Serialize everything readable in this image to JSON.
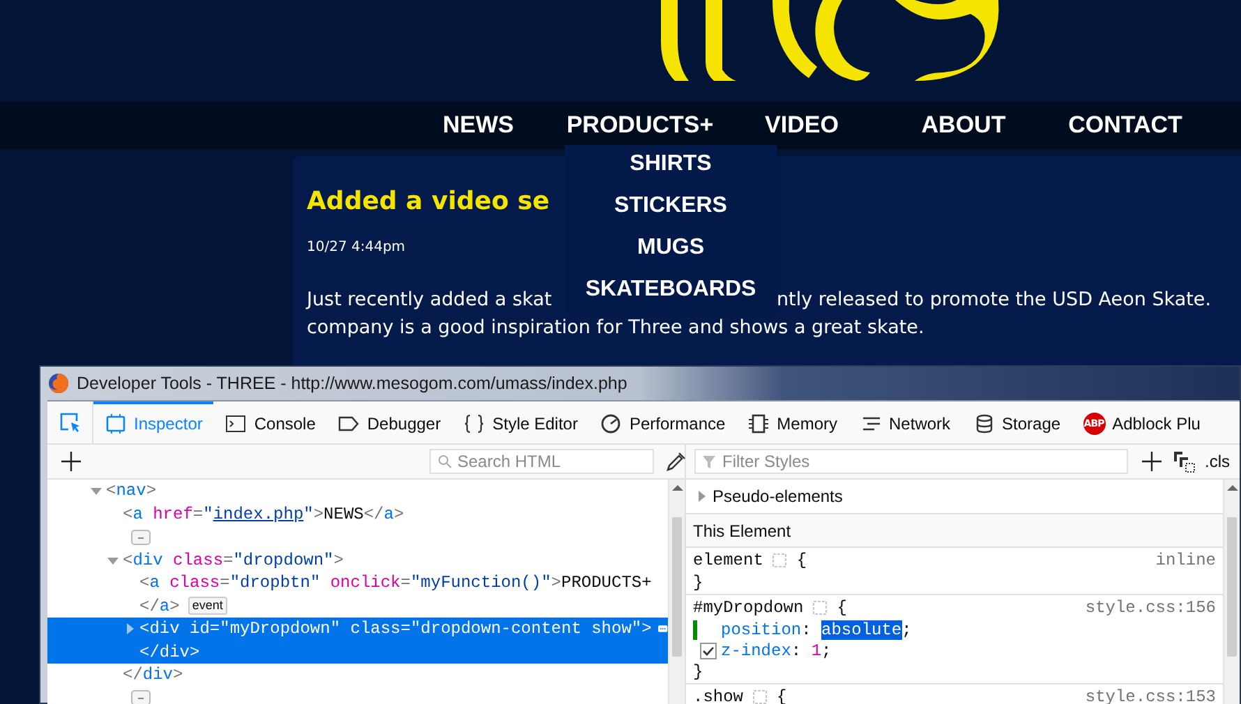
{
  "website": {
    "nav": [
      {
        "label": "NEWS"
      },
      {
        "label": "PRODUCTS+",
        "expanded": true,
        "items": [
          "SHIRTS",
          "STICKERS",
          "MUGS",
          "SKATEBOARDS"
        ]
      },
      {
        "label": "VIDEO"
      },
      {
        "label": "ABOUT"
      },
      {
        "label": "CONTACT"
      }
    ],
    "article": {
      "title": "Added a video se",
      "date": "10/27 4:44pm",
      "line_1_left": "Just recently added a skat",
      "line_1_right": "ntly released to promote the USD Aeon Skate.",
      "line_2": "company is a good inspiration for Three and shows a great skate."
    }
  },
  "devtools": {
    "title": "Developer Tools - THREE - http://www.mesogom.com/umass/index.php",
    "tabs": [
      {
        "kind": "inspector",
        "label": "Inspector",
        "selected": true
      },
      {
        "kind": "console",
        "label": "Console",
        "selected": false
      },
      {
        "kind": "debugger",
        "label": "Debugger",
        "selected": false
      },
      {
        "kind": "style",
        "label": "Style Editor",
        "selected": false
      },
      {
        "kind": "performance",
        "label": "Performance",
        "selected": false
      },
      {
        "kind": "memory",
        "label": "Memory",
        "selected": false
      },
      {
        "kind": "network",
        "label": "Network",
        "selected": false
      },
      {
        "kind": "storage",
        "label": "Storage",
        "selected": false
      },
      {
        "kind": "adblock",
        "label": "Adblock Plu",
        "icon_text": "ABP",
        "selected": false
      }
    ],
    "search_placeholder": "Search HTML",
    "filter_placeholder": "Filter Styles",
    "cls_label": ".cls",
    "markup": [
      {
        "text": "<nav>",
        "expanded": true,
        "selected": false,
        "children": [
          {
            "text": "<a href=\"index.php\">NEWS</a>",
            "link": true,
            "selected": false
          },
          {
            "kind": "whitespace"
          },
          {
            "text": "<div class=\"dropdown\">",
            "expanded": true,
            "selected": false,
            "children": [
              {
                "text": "<a class=\"dropbtn\" onclick=\"myFunction()\">PRODUCTS+",
                "continuation": "</a>",
                "badge": "event",
                "selected": false
              },
              {
                "text": "<div id=\"myDropdown\" class=\"dropdown-content show\">",
                "expanded": false,
                "collapsed_content": true,
                "continuation": "</div>",
                "selected": true
              }
            ],
            "closing": "</div>"
          },
          {
            "kind": "whitespace"
          }
        ]
      }
    ],
    "pseudo": {
      "label": "Pseudo-elements",
      "expanded": false
    },
    "section": "This Element",
    "rules": [
      {
        "selector": "element",
        "open_brace": "{",
        "source": "inline",
        "close_brace": "}"
      },
      {
        "selector": "#myDropdown",
        "open_brace": "{",
        "source": "style.css:156",
        "close_brace": "}",
        "declarations": [
          {
            "property": "position",
            "colon": ":",
            "value": "absolute",
            "semicolon": ";",
            "modified": true,
            "value_selected": true
          },
          {
            "property": "z-index",
            "colon": ":",
            "value": "1",
            "semicolon": ";",
            "checked": true
          }
        ]
      },
      {
        "selector": ".show",
        "open_brace": "{",
        "source": "style.css:153"
      }
    ]
  }
}
